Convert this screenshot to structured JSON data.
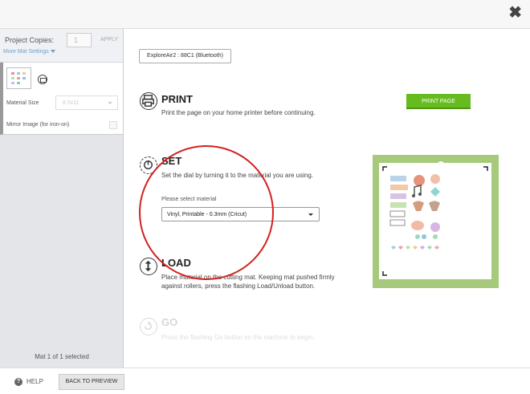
{
  "window": {
    "close_icon": "close-x-icon",
    "close_glyph": "✖"
  },
  "sidebar": {
    "project_copies_label": "Project Copies:",
    "project_copies_value": "1",
    "apply_label": "APPLY",
    "more_mat_settings": "More Mat Settings",
    "mat": {
      "material_size_label": "Material Size",
      "material_size_value": "8.5x11",
      "mirror_label": "Mirror Image (for iron-on)"
    },
    "mat_count": "Mat 1 of 1 selected"
  },
  "bottom": {
    "help": "HELP",
    "back_to_preview": "BACK TO PREVIEW"
  },
  "main": {
    "device": "ExploreAir2 : 88C1 (Bluetooth)",
    "print": {
      "title": "PRINT",
      "desc": "Print the page on your home printer before continuing.",
      "button": "PRINT PAGE"
    },
    "set": {
      "title": "SET",
      "desc": "Set the dial by turning it to the material you are using.",
      "select_label": "Please select material",
      "select_value": "Vinyl, Printable - 0.3mm (Cricut)"
    },
    "load": {
      "title": "LOAD",
      "desc": "Place material on the cutting mat. Keeping mat pushed firmly against rollers, press the flashing Load/Unload button."
    },
    "go": {
      "title": "GO",
      "desc": "Press the flashing Go button on the machine to begin."
    }
  },
  "colors": {
    "accent_green": "#66bb1e",
    "mat_green": "#a6c97c",
    "highlight_red": "#d42020",
    "link_blue": "#6a9fcf"
  }
}
